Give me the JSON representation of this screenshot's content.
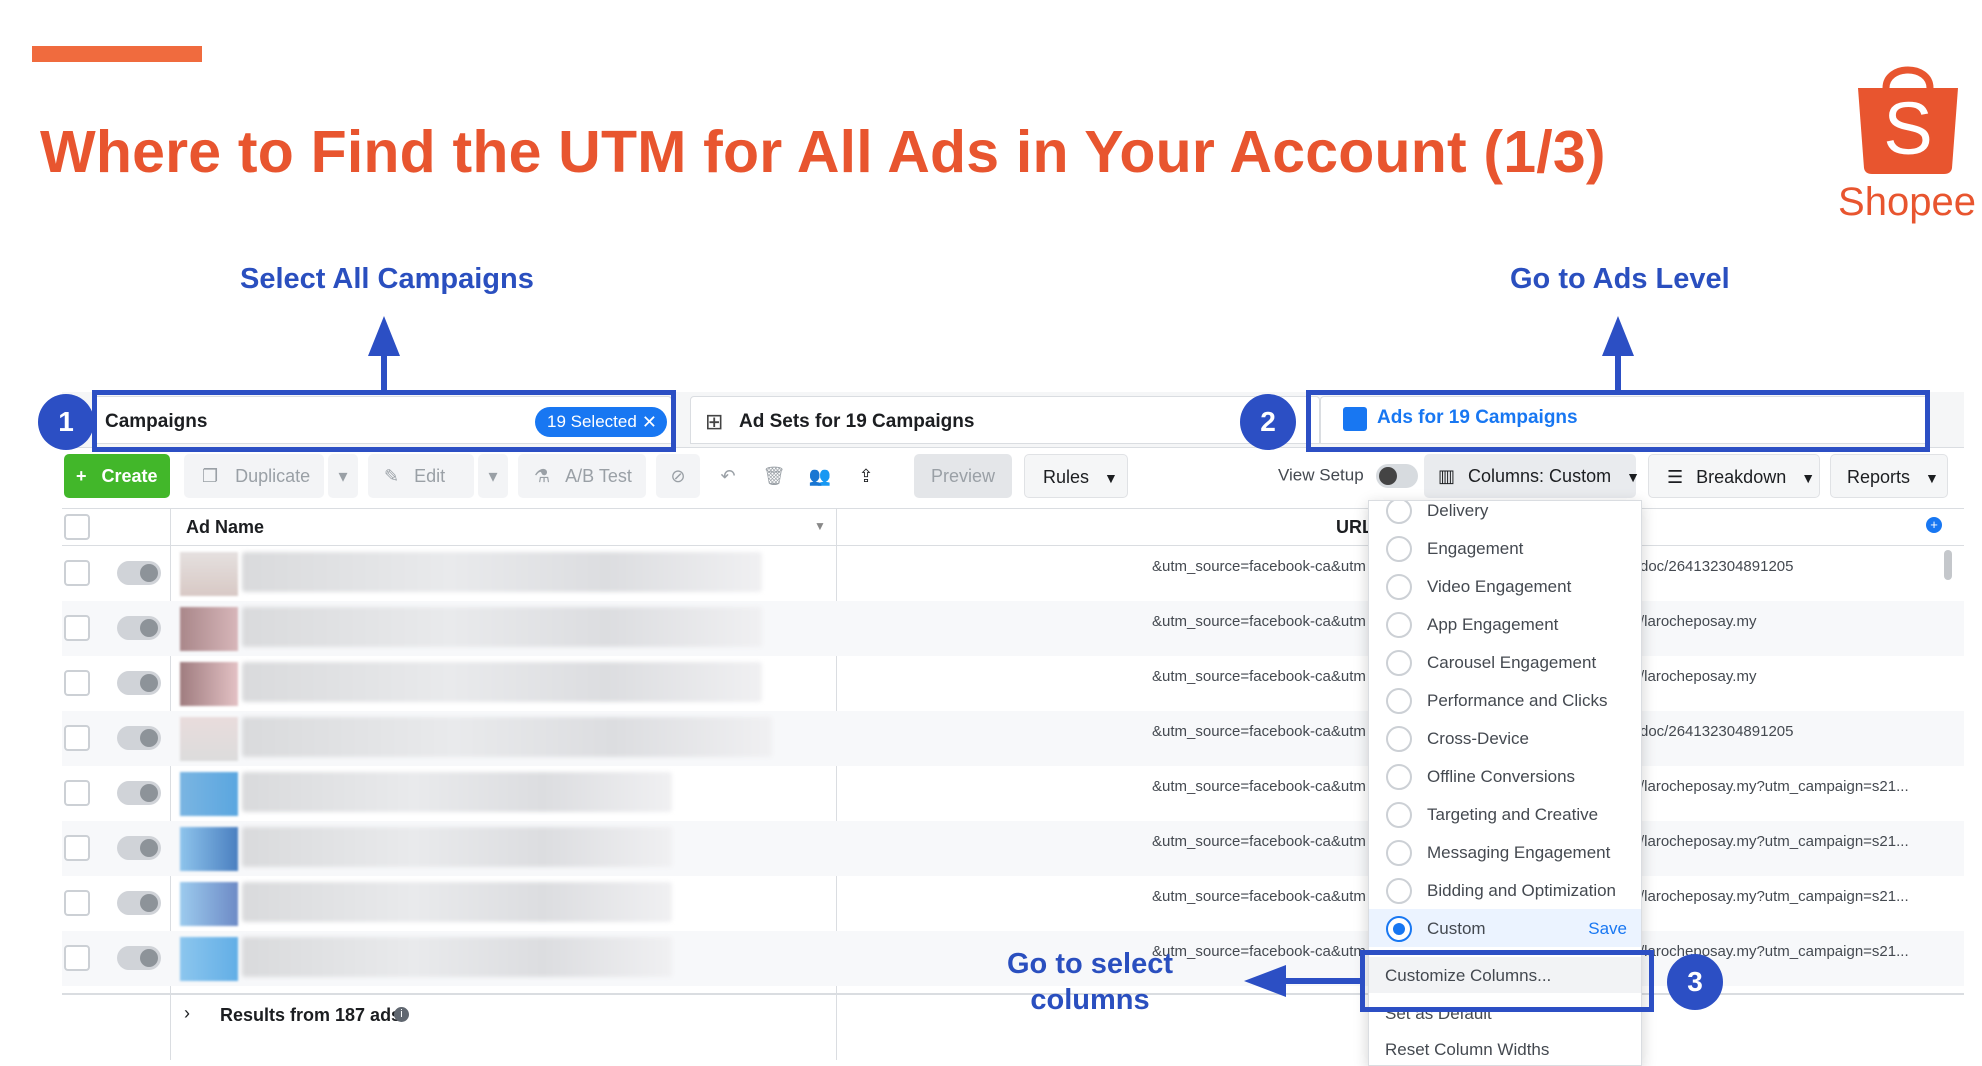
{
  "slide": {
    "title": "Where to Find the UTM for All Ads in Your Account (1/3)",
    "brand": "Shopee",
    "brand_color": "#e8552f",
    "logo_letter": "S"
  },
  "annotations": {
    "select_all": "Select All Campaigns",
    "ads_level": "Go to Ads Level",
    "select_columns_1": "Go to select",
    "select_columns_2": "columns",
    "step1": "1",
    "step2": "2",
    "step3": "3",
    "color": "#2c4fc4"
  },
  "tabs": {
    "campaigns": "Campaigns",
    "selected": "19 Selected",
    "adsets": "Ad Sets for 19 Campaigns",
    "ads": "Ads for 19 Campaigns"
  },
  "toolbar": {
    "create": "Create",
    "duplicate": "Duplicate",
    "edit": "Edit",
    "ab_test": "A/B Test",
    "preview": "Preview",
    "rules": "Rules",
    "view_setup": "View Setup",
    "columns": "Columns: Custom",
    "breakdown": "Breakdown",
    "reports": "Reports"
  },
  "table": {
    "col_ad_name": "Ad Name",
    "col_url": "URL",
    "rows": [
      {
        "url": "&utm_source=facebook-ca&utm",
        "url_tail": "doc/264132304891205"
      },
      {
        "url": "&utm_source=facebook-ca&utm",
        "url_tail": "/larocheposay.my"
      },
      {
        "url": "&utm_source=facebook-ca&utm",
        "url_tail": "/larocheposay.my"
      },
      {
        "url": "&utm_source=facebook-ca&utm",
        "url_tail": "doc/264132304891205"
      },
      {
        "url": "&utm_source=facebook-ca&utm",
        "url_tail": "/larocheposay.my?utm_campaign=s21..."
      },
      {
        "url": "&utm_source=facebook-ca&utm",
        "url_tail": "/larocheposay.my?utm_campaign=s21..."
      },
      {
        "url": "&utm_source=facebook-ca&utm",
        "url_tail": "/larocheposay.my?utm_campaign=s21..."
      },
      {
        "url": "&utm_source=facebook-ca&utm",
        "url_tail": "/larocheposay.my?utm_campaign=s21..."
      }
    ],
    "footer": "Results from 187 ads"
  },
  "columns_menu": {
    "items": [
      "Delivery",
      "Engagement",
      "Video Engagement",
      "App Engagement",
      "Carousel Engagement",
      "Performance and Clicks",
      "Cross-Device",
      "Offline Conversions",
      "Targeting and Creative",
      "Messaging Engagement",
      "Bidding and Optimization"
    ],
    "custom": "Custom",
    "save": "Save",
    "customize": "Customize Columns...",
    "set_default": "Set as Default",
    "reset_widths": "Reset Column Widths"
  }
}
